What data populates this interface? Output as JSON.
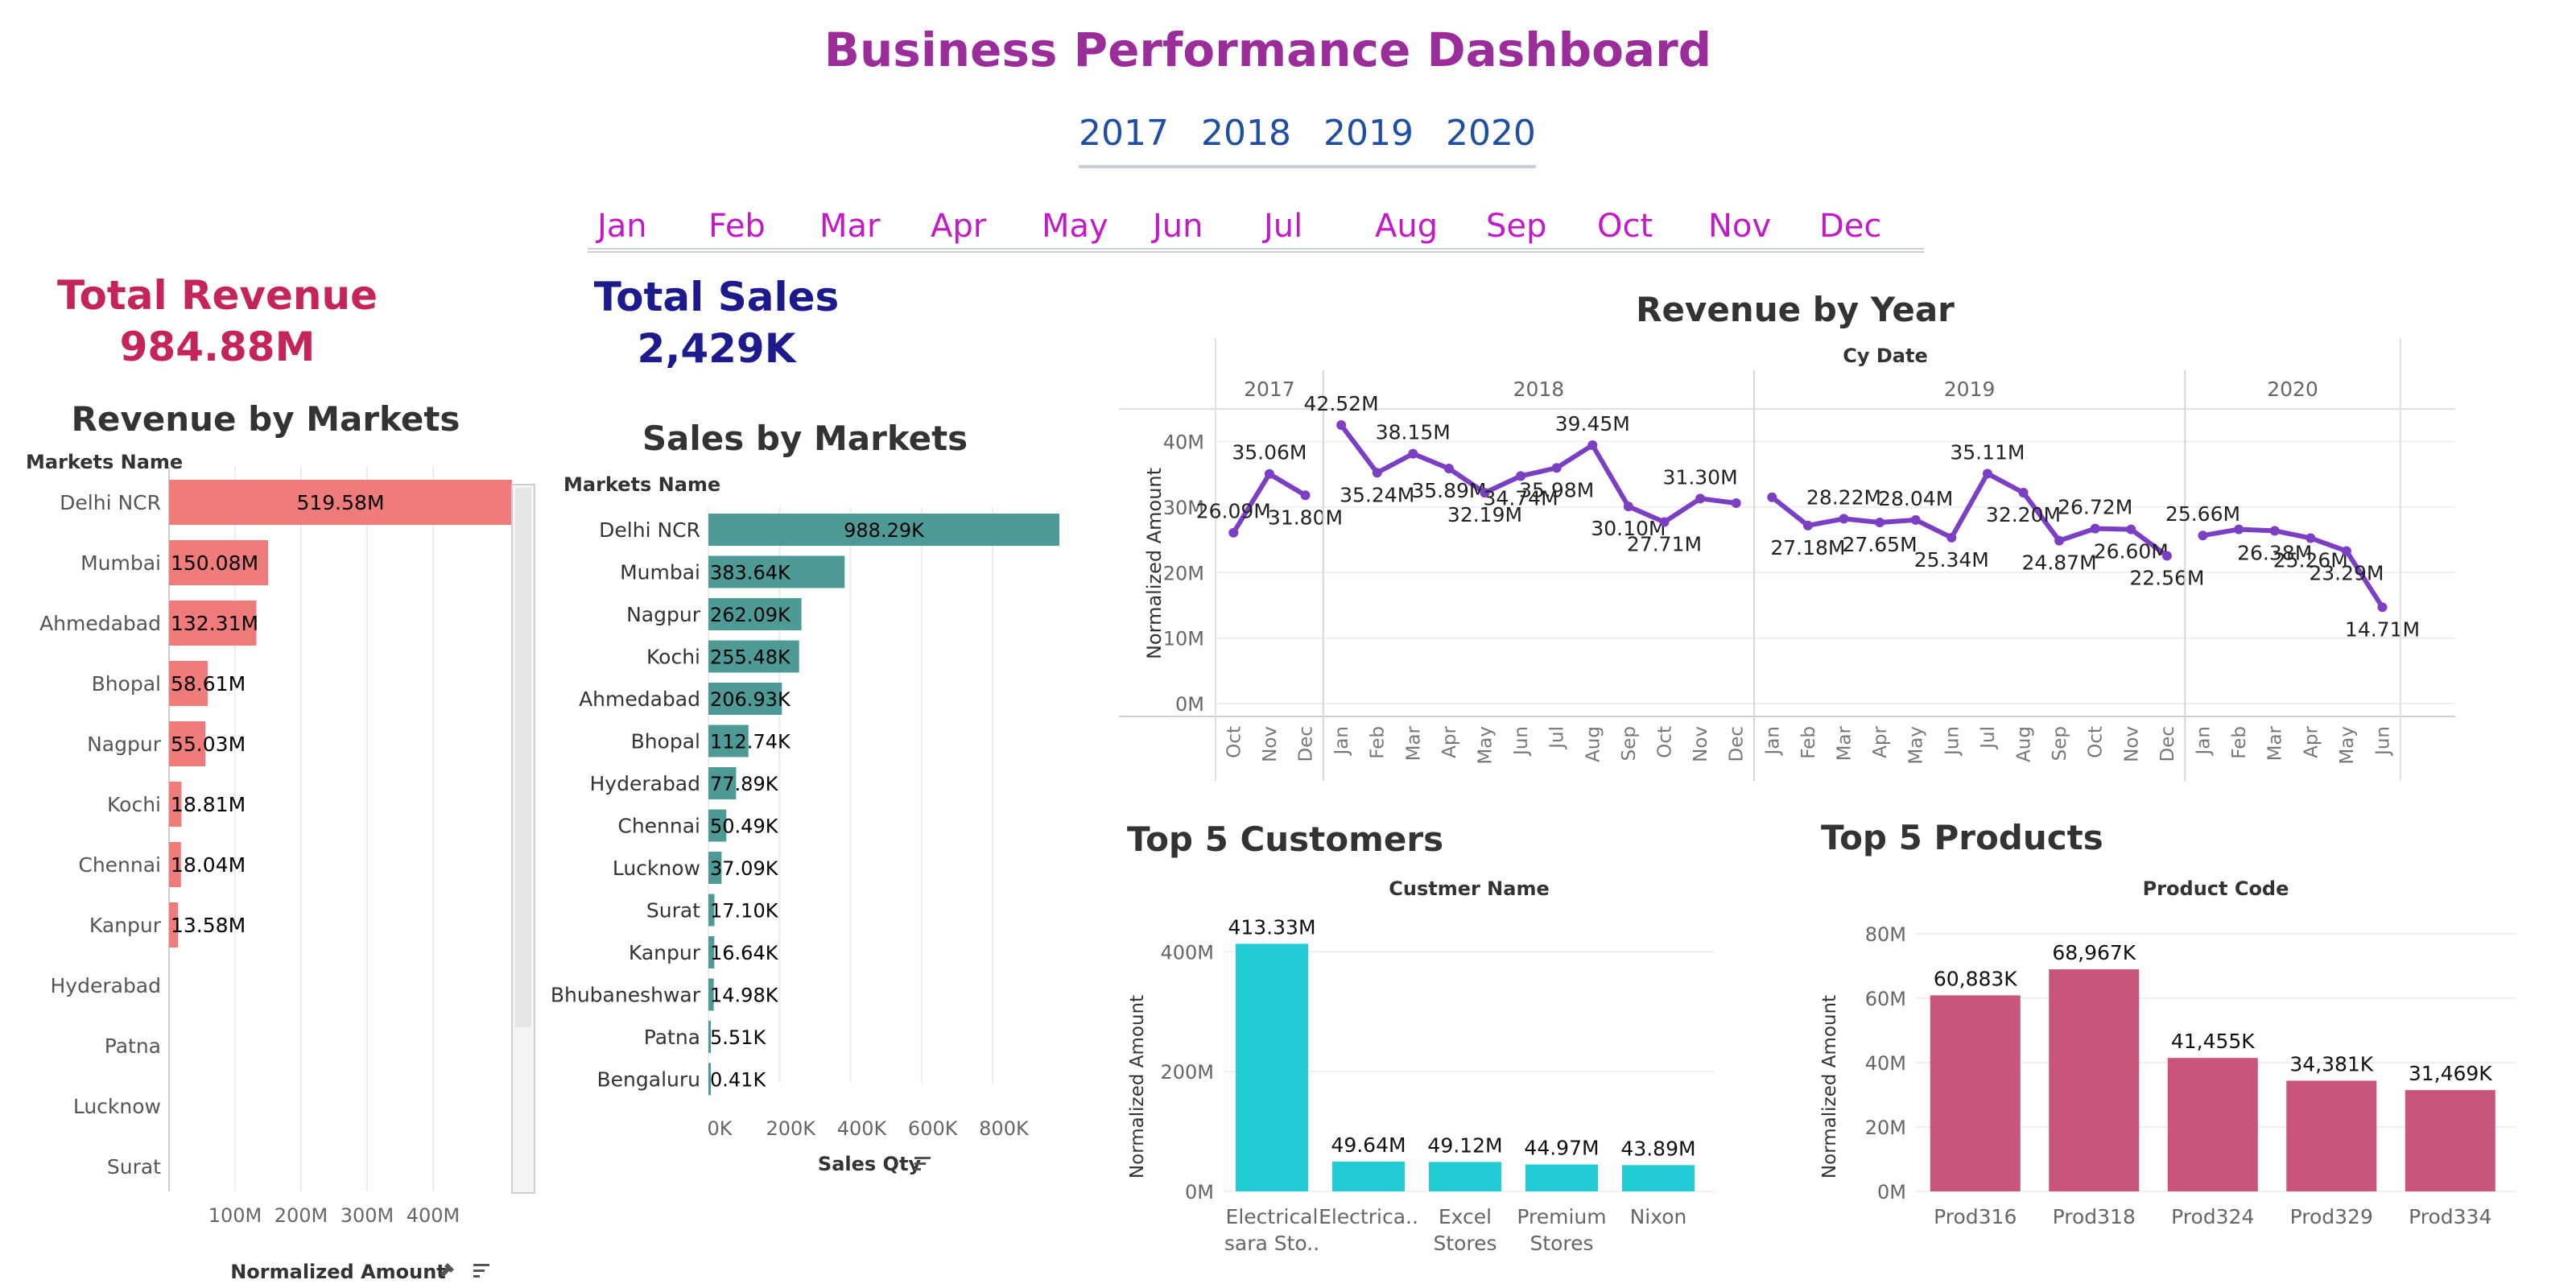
{
  "title": "Business Performance Dashboard",
  "year_filter": [
    "2017",
    "2018",
    "2019",
    "2020"
  ],
  "month_filter": [
    "Jan",
    "Feb",
    "Mar",
    "Apr",
    "May",
    "Jun",
    "Jul",
    "Aug",
    "Sep",
    "Oct",
    "Nov",
    "Dec"
  ],
  "kpis": {
    "revenue_label": "Total Revenue",
    "revenue_value": "984.88M",
    "sales_label": "Total Sales",
    "sales_value": "2,429K"
  },
  "colors": {
    "title": "#9b2d9b",
    "year_filter": "#1f4fa3",
    "month_filter": "#c21ac9",
    "revenue_kpi": "#c4245a",
    "sales_kpi": "#1c1a8c",
    "revenue_bars": "#f07b7b",
    "sales_bars": "#4e9a96",
    "line": "#7b3fc4",
    "customer_bars": "#22ccd4",
    "product_bars": "#c9557a"
  },
  "icons": [
    "pin-icon",
    "sort-icon"
  ],
  "chart_data": [
    {
      "id": "revenue_by_markets",
      "type": "bar",
      "orientation": "horizontal",
      "title": "Revenue by Markets",
      "row_header": "Markets Name",
      "xlabel": "Normalized Amount",
      "categories": [
        "Delhi NCR",
        "Mumbai",
        "Ahmedabad",
        "Bhopal",
        "Nagpur",
        "Kochi",
        "Chennai",
        "Kanpur",
        "Hyderabad",
        "Patna",
        "Lucknow",
        "Surat"
      ],
      "values": [
        519.58,
        150.08,
        132.31,
        58.61,
        55.03,
        18.81,
        18.04,
        13.58,
        0,
        0,
        0,
        0
      ],
      "labels": [
        "519.58M",
        "150.08M",
        "132.31M",
        "58.61M",
        "55.03M",
        "18.81M",
        "18.04M",
        "13.58M",
        "",
        "",
        "",
        ""
      ],
      "xticks": [
        "100M",
        "200M",
        "300M",
        "400M"
      ],
      "xtick_values": [
        100,
        200,
        300,
        400
      ],
      "xlim": [
        0,
        519.58
      ],
      "grid": true
    },
    {
      "id": "sales_by_markets",
      "type": "bar",
      "orientation": "horizontal",
      "title": "Sales by Markets",
      "row_header": "Markets Name",
      "xlabel": "Sales Qty",
      "categories": [
        "Delhi NCR",
        "Mumbai",
        "Nagpur",
        "Kochi",
        "Ahmedabad",
        "Bhopal",
        "Hyderabad",
        "Chennai",
        "Lucknow",
        "Surat",
        "Kanpur",
        "Bhubaneshwar",
        "Patna",
        "Bengaluru"
      ],
      "values": [
        988.29,
        383.64,
        262.09,
        255.48,
        206.93,
        112.74,
        77.89,
        50.49,
        37.09,
        17.1,
        16.64,
        14.98,
        5.51,
        0.41
      ],
      "labels": [
        "988.29K",
        "383.64K",
        "262.09K",
        "255.48K",
        "206.93K",
        "112.74K",
        "77.89K",
        "50.49K",
        "37.09K",
        "17.10K",
        "16.64K",
        "14.98K",
        "5.51K",
        "0.41K"
      ],
      "xticks": [
        "0K",
        "200K",
        "400K",
        "600K",
        "800K"
      ],
      "xtick_values": [
        0,
        200,
        400,
        600,
        800
      ],
      "xlim": [
        0,
        1020
      ],
      "grid": true
    },
    {
      "id": "revenue_by_year",
      "type": "line",
      "title": "Revenue by Year",
      "header": "Cy Date",
      "ylabel": "Normalized Amount",
      "yticks": [
        "0M",
        "10M",
        "20M",
        "30M",
        "40M"
      ],
      "ytick_values": [
        0,
        10,
        20,
        30,
        40
      ],
      "ylim": [
        0,
        44
      ],
      "grid": true,
      "years": [
        {
          "year": "2017",
          "months": [
            "Oct",
            "Nov",
            "Dec"
          ],
          "values": [
            26.09,
            35.06,
            31.8
          ],
          "labels": [
            "26.09M",
            "35.06M",
            "31.80M"
          ]
        },
        {
          "year": "2018",
          "months": [
            "Jan",
            "Feb",
            "Mar",
            "Apr",
            "May",
            "Jun",
            "Jul",
            "Aug",
            "Sep",
            "Oct",
            "Nov",
            "Dec"
          ],
          "values": [
            42.52,
            35.24,
            38.15,
            35.89,
            32.19,
            34.74,
            35.98,
            39.45,
            30.1,
            27.71,
            31.3,
            30.6
          ],
          "labels": [
            "42.52M",
            "35.24M",
            "38.15M",
            "35.89M",
            "32.19M",
            "34.74M",
            "35.98M",
            "39.45M",
            "30.10M",
            "27.71M",
            "31.30M",
            ""
          ]
        },
        {
          "year": "2019",
          "months": [
            "Jan",
            "Feb",
            "Mar",
            "Apr",
            "May",
            "Jun",
            "Jul",
            "Aug",
            "Sep",
            "Oct",
            "Nov",
            "Dec"
          ],
          "values": [
            31.5,
            27.18,
            28.22,
            27.65,
            28.04,
            25.34,
            35.11,
            32.2,
            24.87,
            26.72,
            26.6,
            22.56
          ],
          "labels": [
            "",
            "27.18M",
            "28.22M",
            "27.65M",
            "28.04M",
            "25.34M",
            "35.11M",
            "32.20M",
            "24.87M",
            "26.72M",
            "26.60M",
            "22.56M"
          ]
        },
        {
          "year": "2020",
          "months": [
            "Jan",
            "Feb",
            "Mar",
            "Apr",
            "May",
            "Jun"
          ],
          "values": [
            25.66,
            26.6,
            26.38,
            25.26,
            23.29,
            14.71
          ],
          "labels": [
            "25.66M",
            "",
            "26.38M",
            "25.26M",
            "23.29M",
            "14.71M"
          ]
        }
      ]
    },
    {
      "id": "top5_customers",
      "type": "bar",
      "title": "Top 5 Customers",
      "header": "Custmer Name",
      "ylabel": "Normalized Amount",
      "categories": [
        "Electrical sara Sto..",
        "Electrica..",
        "Excel Stores",
        "Premium Stores",
        "Nixon"
      ],
      "category_lines": [
        [
          "Electrical",
          "sara Sto.."
        ],
        [
          "Electrica.."
        ],
        [
          "Excel",
          "Stores"
        ],
        [
          "Premium",
          "Stores"
        ],
        [
          "Nixon"
        ]
      ],
      "values": [
        413.33,
        49.64,
        49.12,
        44.97,
        43.89
      ],
      "labels": [
        "413.33M",
        "49.64M",
        "49.12M",
        "44.97M",
        "43.89M"
      ],
      "yticks": [
        "0M",
        "200M",
        "400M"
      ],
      "ytick_values": [
        0,
        200,
        400
      ],
      "ylim": [
        0,
        430
      ],
      "grid": true
    },
    {
      "id": "top5_products",
      "type": "bar",
      "title": "Top 5 Products",
      "header": "Product Code",
      "ylabel": "Normalized Amount",
      "categories": [
        "Prod316",
        "Prod318",
        "Prod324",
        "Prod329",
        "Prod334"
      ],
      "values": [
        60.883,
        68.967,
        41.455,
        34.381,
        31.469
      ],
      "labels": [
        "60,883K",
        "68,967K",
        "41,455K",
        "34,381K",
        "31,469K"
      ],
      "yticks": [
        "0M",
        "20M",
        "40M",
        "60M",
        "80M"
      ],
      "ytick_values": [
        0,
        20,
        40,
        60,
        80
      ],
      "ylim": [
        0,
        80
      ],
      "grid": true
    }
  ]
}
